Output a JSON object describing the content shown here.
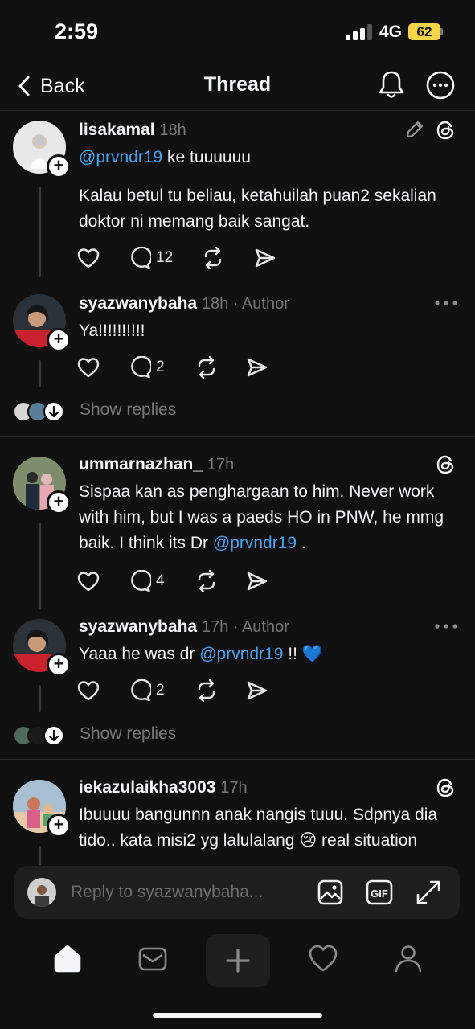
{
  "status": {
    "time": "2:59",
    "network": "4G",
    "battery": "62"
  },
  "nav": {
    "back_label": "Back",
    "title": "Thread"
  },
  "posts": [
    {
      "username": "lisakamal",
      "meta": "18h",
      "mention": "@prvndr19",
      "text_after_mention": " ke tuuuuuu",
      "paragraph": "Kalau betul tu beliau, ketahuilah puan2 sekalian doktor ni memang baik sangat.",
      "replies": "12"
    },
    {
      "username": "syazwanybaha",
      "meta": "18h · Author",
      "text": "Ya!!!!!!!!!!",
      "replies": "2"
    },
    {
      "username": "ummarnazhan_",
      "meta": "17h",
      "text_before_mention": "Sispaa kan as penghargaan to him. Never work with him, but I was a paeds HO in PNW, he mmg baik. I think its Dr ",
      "mention": "@prvndr19",
      "text_after_mention": " .",
      "replies": "4"
    },
    {
      "username": "syazwanybaha",
      "meta": "17h · Author",
      "text_before_mention": "Yaaa he was dr ",
      "mention": "@prvndr19",
      "text_after_mention": " !! 💙",
      "replies": "2"
    },
    {
      "username": "iekazulaikha3003",
      "meta": "17h",
      "text": "Ibuuuu bangunnn anak nangis tuuu. Sdpnya dia tido.. kata misi2 yg lalulalang 😢 real situation"
    }
  ],
  "show_replies_label": "Show replies",
  "reply_bar": {
    "placeholder": "Reply to syazwanybaha..."
  },
  "colors": {
    "background": "#101010",
    "mention": "#4aa3f0",
    "muted": "#777777",
    "battery": "#f7d448"
  }
}
